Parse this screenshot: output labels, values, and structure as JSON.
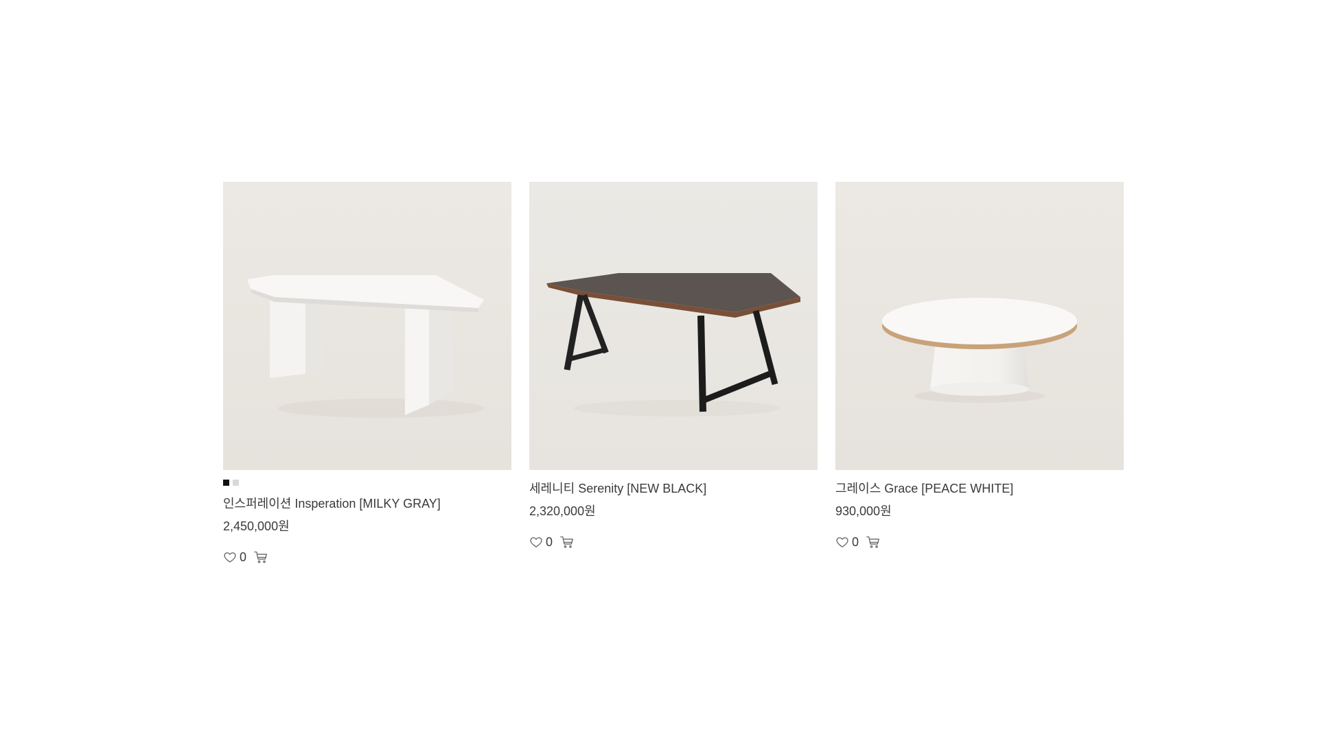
{
  "products": [
    {
      "name": "인스퍼레이션 Insperation [MILKY GRAY]",
      "price": "2,450,000원",
      "likes": "0",
      "image_icon": "white-dining-table-image",
      "swatches": [
        {
          "color": "#111111",
          "label": "black"
        },
        {
          "color": "#d9d9d9",
          "label": "light-gray"
        }
      ]
    },
    {
      "name": "세레니티 Serenity [NEW BLACK]",
      "price": "2,320,000원",
      "likes": "0",
      "image_icon": "black-table-image",
      "swatches": []
    },
    {
      "name": "그레이스 Grace [PEACE WHITE]",
      "price": "930,000원",
      "likes": "0",
      "image_icon": "round-coffee-table-image",
      "swatches": []
    }
  ],
  "icons": {
    "like": "heart-icon",
    "cart": "cart-icon"
  },
  "colors": {
    "image_background": "#ebe8e3",
    "text": "#3a3a3a",
    "icon": "#666666"
  }
}
